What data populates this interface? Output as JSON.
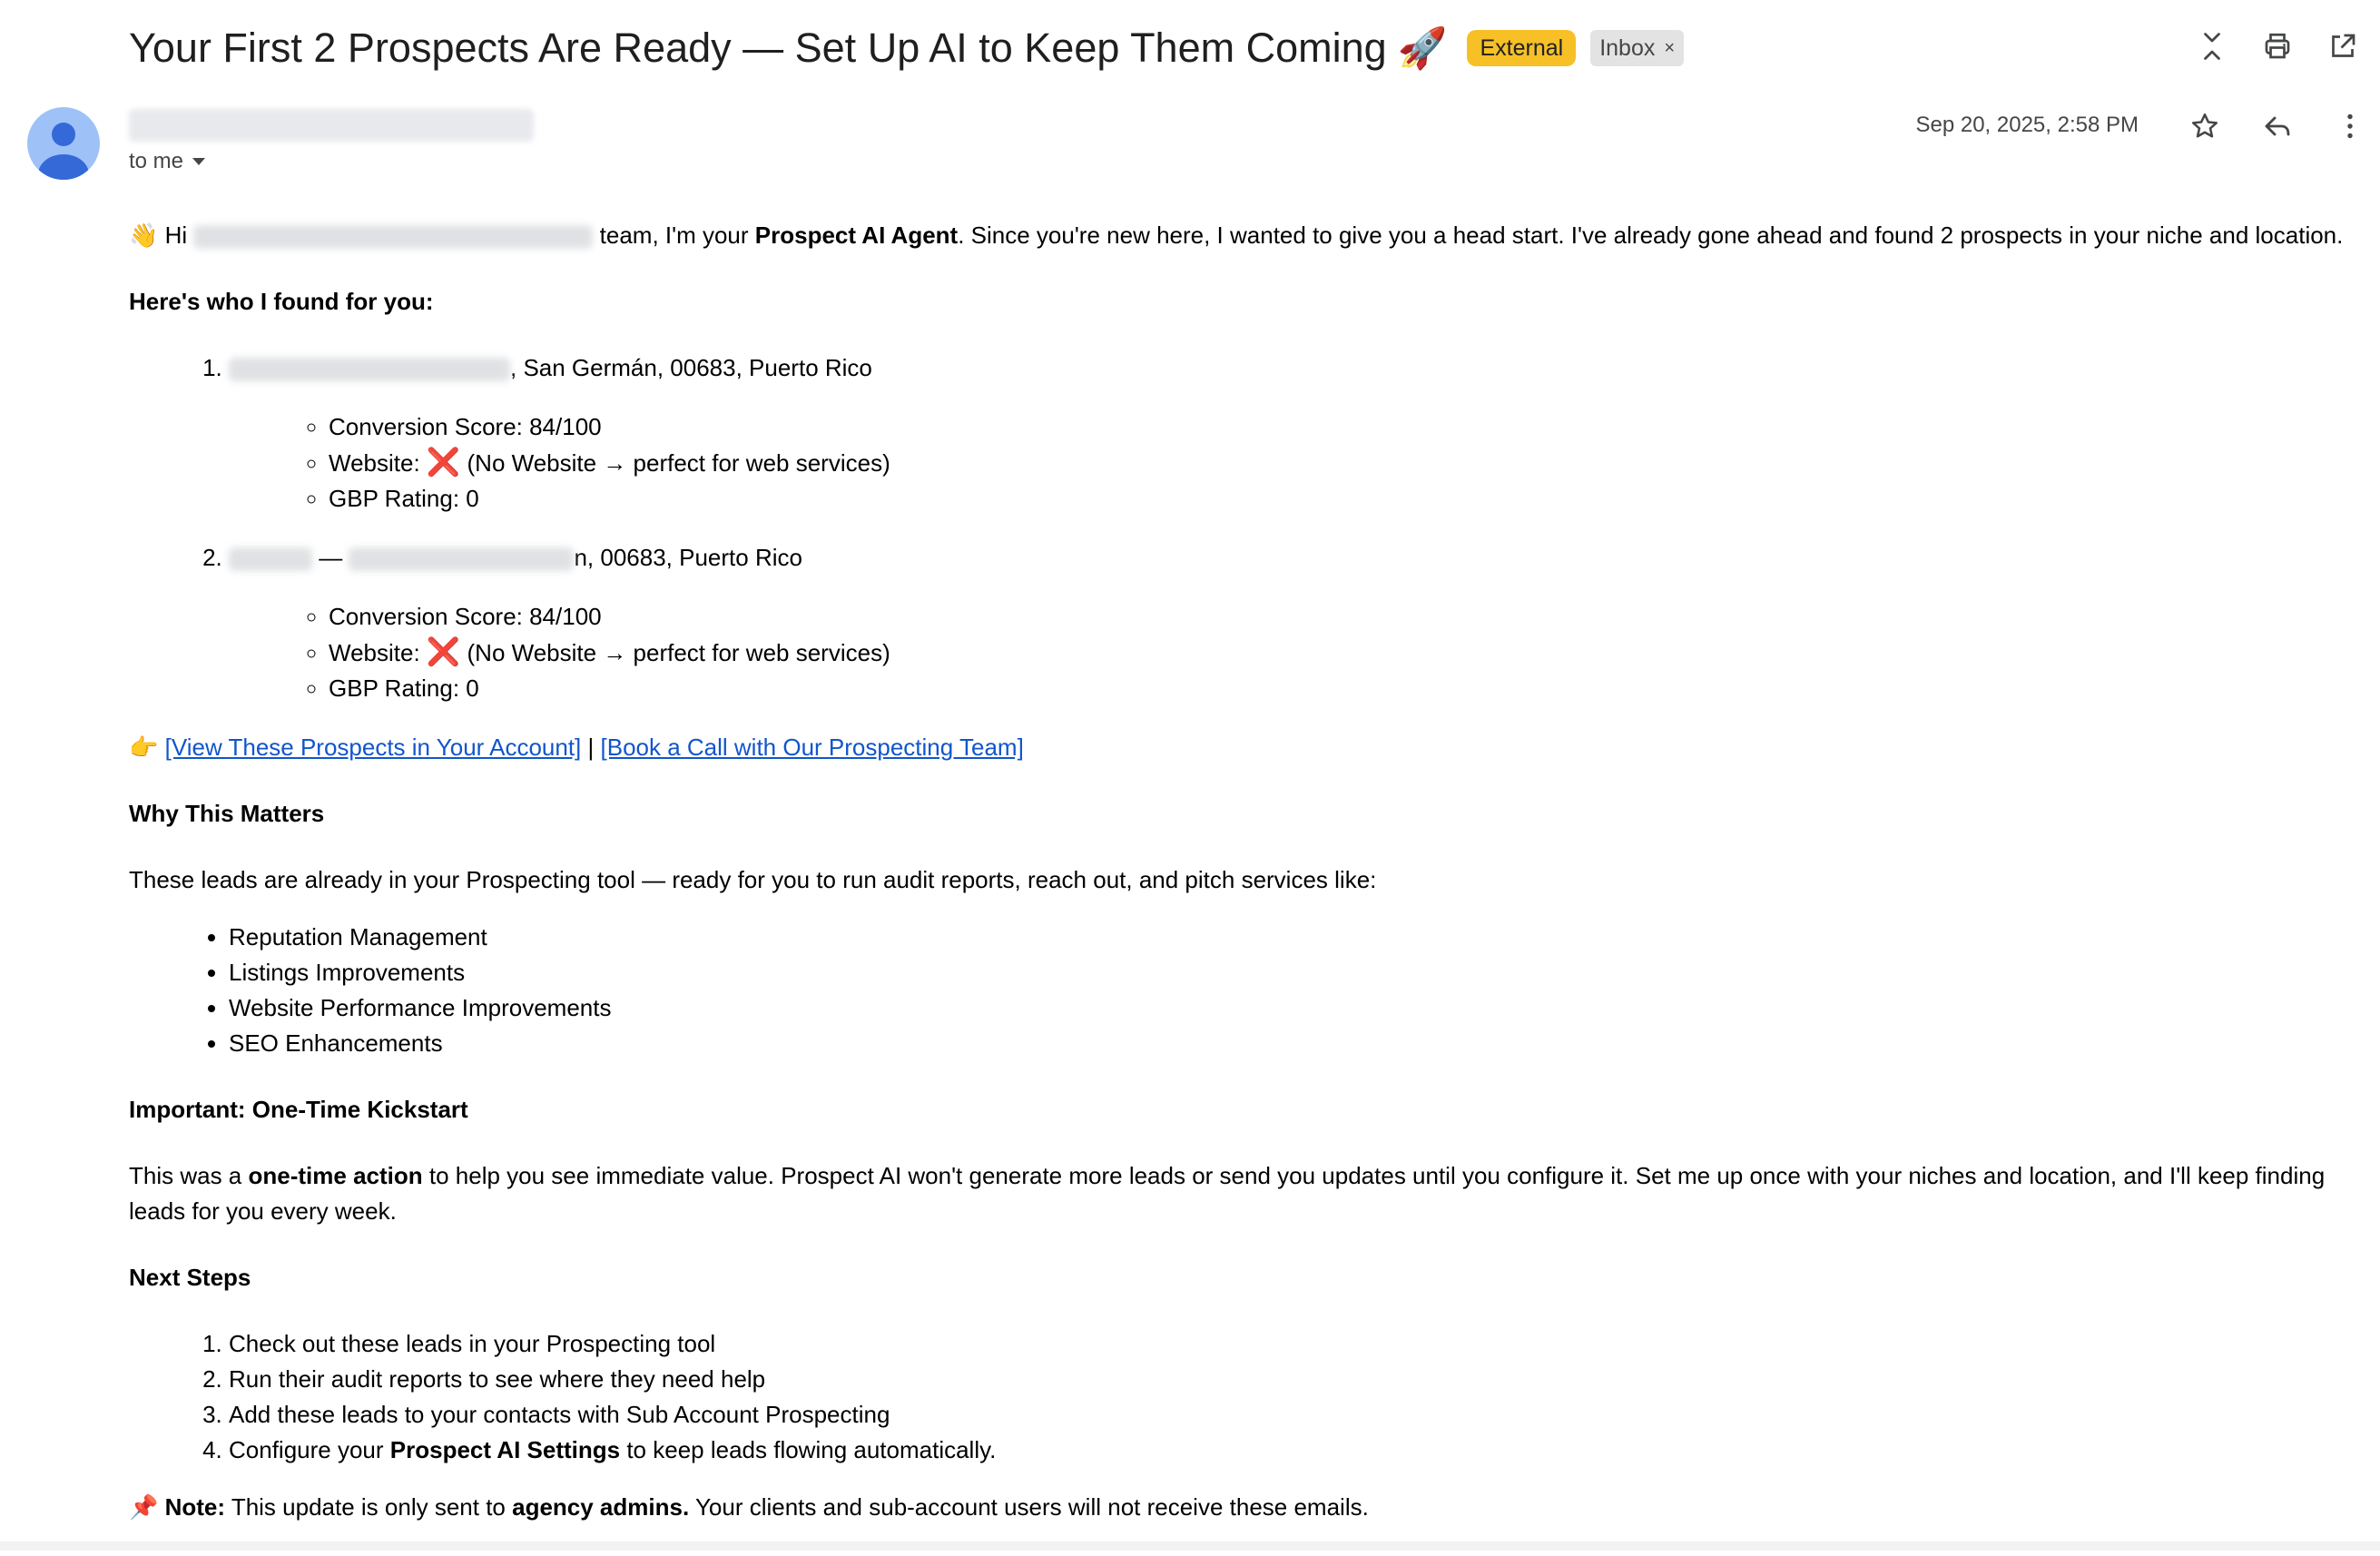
{
  "header": {
    "subject": "Your First 2 Prospects Are Ready — Set Up AI to Keep Them Coming",
    "subject_emoji": "🚀",
    "label_external": "External",
    "label_inbox": "Inbox",
    "label_remove": "×",
    "icons": [
      "collapse-icon",
      "print-icon",
      "open-in-new-window-icon"
    ]
  },
  "message": {
    "to": "to me",
    "date": "Sep 20, 2025, 2:58 PM",
    "icons": [
      "star-icon",
      "reply-icon",
      "more-vert-icon"
    ]
  },
  "email": {
    "greeting_emoji": "👋",
    "greeting_hi": "Hi",
    "greeting_after": "team, I'm your",
    "agent_name": "Prospect AI Agent",
    "greeting_rest": ". Since you're new here, I wanted to give you a head start. I've already gone ahead and found 2 prospects in your niche and location.",
    "found_heading": "Here's who I found for you:",
    "prospects": [
      {
        "location": ", San Germán, 00683, Puerto Rico",
        "score": "Conversion Score: 84/100",
        "website_label": "Website:",
        "website_mark": "❌",
        "website_note": "(No Website → perfect for web services)",
        "rating": "GBP Rating: 0"
      },
      {
        "dash": "—",
        "location": "n, 00683, Puerto Rico",
        "score": "Conversion Score: 84/100",
        "website_label": "Website:",
        "website_mark": "❌",
        "website_note": "(No Website → perfect for web services)",
        "rating": "GBP Rating: 0"
      }
    ],
    "cta_emoji": "👉",
    "cta_link1": "[View These Prospects in Your Account]",
    "cta_sep": "|",
    "cta_link2": "[Book a Call with Our Prospecting Team]",
    "why_heading": "Why This Matters",
    "why_text": "These leads are already in your Prospecting tool — ready for you to run audit reports, reach out, and pitch services like:",
    "services": [
      "Reputation Management",
      "Listings Improvements",
      "Website Performance Improvements",
      "SEO Enhancements"
    ],
    "important_heading": "Important: One-Time Kickstart",
    "important_pre": "This was a",
    "important_bold": "one-time action",
    "important_post": "to help you see immediate value. Prospect AI won't generate more leads or send you updates until you configure it. Set me up once with your niches and location, and I'll keep finding leads for you every week.",
    "next_heading": "Next Steps",
    "steps": [
      "Check out these leads in your Prospecting tool",
      "Run their audit reports to see where they need help",
      "Add these leads to your contacts with Sub Account Prospecting"
    ],
    "step4_pre": "Configure your",
    "step4_bold": "Prospect AI Settings",
    "step4_post": "to keep leads flowing automatically.",
    "note_emoji": "📌",
    "note_label": "Note:",
    "note_pre": "This update is only sent to",
    "note_bold": "agency admins.",
    "note_post": "Your clients and sub-account users will not receive these emails."
  }
}
